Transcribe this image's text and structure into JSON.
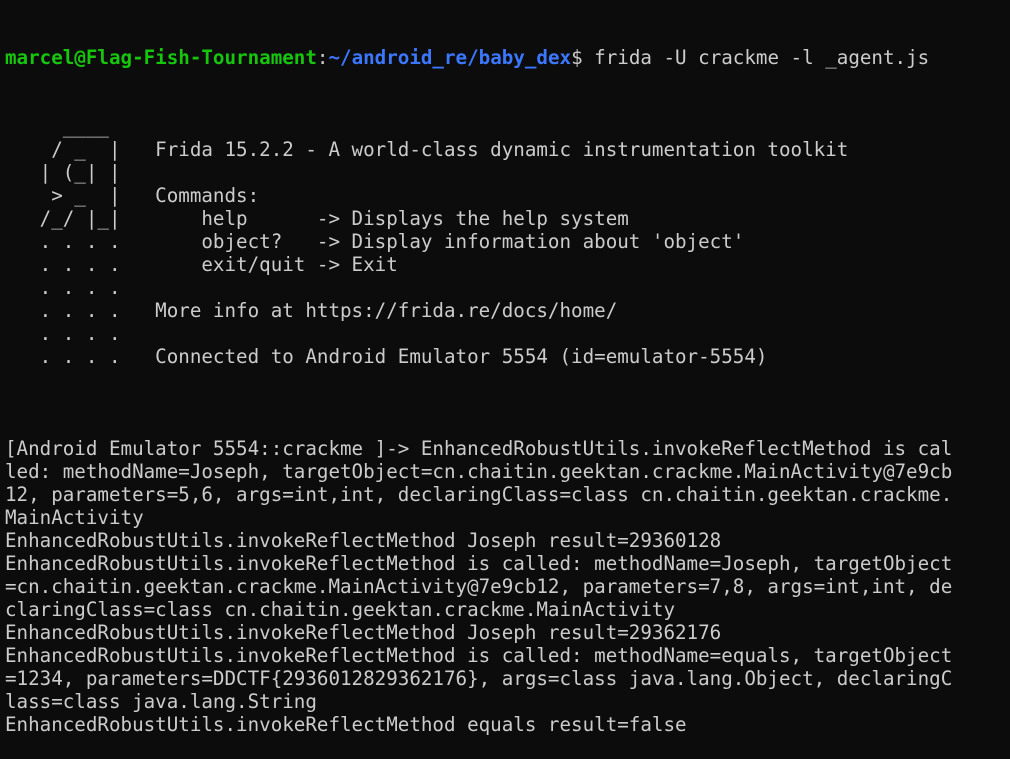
{
  "window": {
    "background": "#0c0c0c",
    "foreground": "#cccccc",
    "prompt_user_color": "#16c60c",
    "prompt_path_color": "#3b78ff"
  },
  "prompt": {
    "user_host": "marcel@Flag-Fish-Tournament",
    "separator": ":",
    "path": "~/android_re/baby_dex",
    "symbol": "$",
    "command": " frida -U crackme -l _agent.js"
  },
  "banner": [
    "     ____",
    "    / _  |   Frida 15.2.2 - A world-class dynamic instrumentation toolkit",
    "   | (_| |",
    "    > _  |   Commands:",
    "   /_/ |_|       help      -> Displays the help system",
    "   . . . .       object?   -> Display information about 'object'",
    "   . . . .       exit/quit -> Exit",
    "   . . . .",
    "   . . . .   More info at https://frida.re/docs/home/",
    "   . . . .",
    "   . . . .   Connected to Android Emulator 5554 (id=emulator-5554)",
    ""
  ],
  "output": [
    "[Android Emulator 5554::crackme ]-> EnhancedRobustUtils.invokeReflectMethod is cal",
    "led: methodName=Joseph, targetObject=cn.chaitin.geektan.crackme.MainActivity@7e9cb",
    "12, parameters=5,6, args=int,int, declaringClass=class cn.chaitin.geektan.crackme.",
    "MainActivity",
    "EnhancedRobustUtils.invokeReflectMethod Joseph result=29360128",
    "EnhancedRobustUtils.invokeReflectMethod is called: methodName=Joseph, targetObject",
    "=cn.chaitin.geektan.crackme.MainActivity@7e9cb12, parameters=7,8, args=int,int, de",
    "claringClass=class cn.chaitin.geektan.crackme.MainActivity",
    "EnhancedRobustUtils.invokeReflectMethod Joseph result=29362176",
    "EnhancedRobustUtils.invokeReflectMethod is called: methodName=equals, targetObject",
    "=1234, parameters=DDCTF{2936012829362176}, args=class java.lang.Object, declaringC",
    "lass=class java.lang.String",
    "EnhancedRobustUtils.invokeReflectMethod equals result=false"
  ]
}
